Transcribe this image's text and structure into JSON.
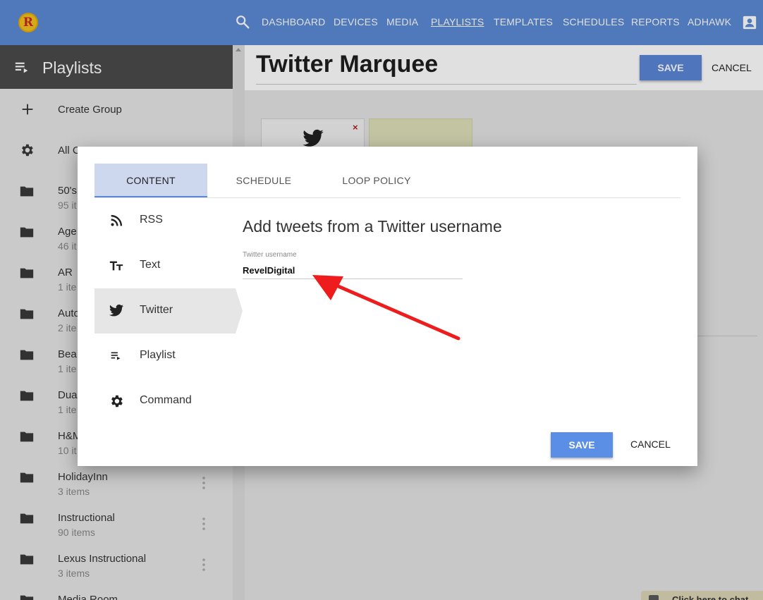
{
  "topnav": {
    "logo_letter": "R",
    "items": [
      {
        "label": "DASHBOARD",
        "active": false
      },
      {
        "label": "DEVICES",
        "active": false
      },
      {
        "label": "MEDIA",
        "active": false
      },
      {
        "label": "PLAYLISTS",
        "active": true
      },
      {
        "label": "TEMPLATES",
        "active": false
      },
      {
        "label": "SCHEDULES",
        "active": false
      },
      {
        "label": "REPORTS",
        "active": false
      },
      {
        "label": "ADHAWK",
        "active": false
      }
    ]
  },
  "sidebar": {
    "title": "Playlists",
    "create_group_label": "Create Group",
    "all_label": "All C",
    "groups": [
      {
        "name": "50's",
        "count": "95 it"
      },
      {
        "name": "Age",
        "count": "46 it"
      },
      {
        "name": "AR",
        "count": "1 ite"
      },
      {
        "name": "Auto",
        "count": "2 ite"
      },
      {
        "name": "Bea",
        "count": "1 ite"
      },
      {
        "name": "Dua",
        "count": "1 ite"
      },
      {
        "name": "H&M",
        "count": "10 it"
      },
      {
        "name": "HolidayInn",
        "count": "3 items"
      },
      {
        "name": "Instructional",
        "count": "90 items"
      },
      {
        "name": "Lexus Instructional",
        "count": "3 items"
      },
      {
        "name": "Media Room",
        "count": ""
      }
    ]
  },
  "main": {
    "title": "Twitter Marquee",
    "save_label": "SAVE",
    "cancel_label": "CANCEL",
    "tile_remove_symbol": "×",
    "chat_label": "Click here to chat"
  },
  "modal": {
    "tabs": [
      {
        "label": "CONTENT",
        "active": true
      },
      {
        "label": "SCHEDULE",
        "active": false
      },
      {
        "label": "LOOP POLICY",
        "active": false
      }
    ],
    "menu": [
      {
        "label": "RSS",
        "icon": "rss-icon",
        "active": false
      },
      {
        "label": "Text",
        "icon": "text-size-icon",
        "active": false
      },
      {
        "label": "Twitter",
        "icon": "twitter-icon",
        "active": true
      },
      {
        "label": "Playlist",
        "icon": "playlist-icon",
        "active": false
      },
      {
        "label": "Command",
        "icon": "gear-icon",
        "active": false
      }
    ],
    "heading": "Add tweets from a Twitter username",
    "field_label": "Twitter username",
    "field_value": "RevelDigital",
    "save_label": "SAVE",
    "cancel_label": "CANCEL"
  }
}
